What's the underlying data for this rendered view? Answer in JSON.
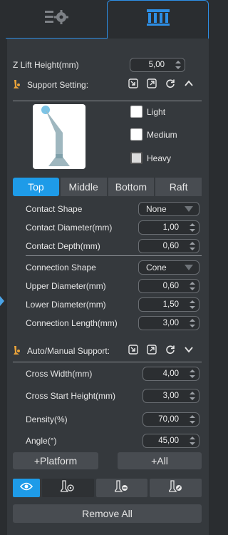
{
  "tabs": [
    {
      "name": "settings-tab",
      "icon": "list-gear-icon",
      "active": false
    },
    {
      "name": "support-tab",
      "icon": "support-pillars-icon",
      "active": true
    }
  ],
  "z_lift": {
    "label": "Z Lift Height(mm)",
    "value": "5,00"
  },
  "support_setting": {
    "title": "Support Setting:"
  },
  "density_options": [
    {
      "label": "Light",
      "checked": false
    },
    {
      "label": "Medium",
      "checked": false
    },
    {
      "label": "Heavy",
      "checked": true
    }
  ],
  "segments": [
    "Top",
    "Middle",
    "Bottom",
    "Raft"
  ],
  "active_segment": "Top",
  "top_params": {
    "contact_shape": {
      "label": "Contact Shape",
      "value": "None"
    },
    "contact_diameter": {
      "label": "Contact Diameter(mm)",
      "value": "1,00"
    },
    "contact_depth": {
      "label": "Contact Depth(mm)",
      "value": "0,60"
    }
  },
  "middle_params": {
    "connection_shape": {
      "label": "Connection Shape",
      "value": "Cone"
    },
    "upper_diameter": {
      "label": "Upper Diameter(mm)",
      "value": "0,60"
    },
    "lower_diameter": {
      "label": "Lower Diameter(mm)",
      "value": "1,50"
    },
    "connection_length": {
      "label": "Connection Length(mm)",
      "value": "3,00"
    }
  },
  "auto_support": {
    "title": "Auto/Manual Support:",
    "cross_width": {
      "label": "Cross Width(mm)",
      "value": "4,00"
    },
    "cross_start_height": {
      "label": "Cross Start Height(mm)",
      "value": "3,00"
    },
    "density": {
      "label": "Density(%)",
      "value": "70,00"
    },
    "angle": {
      "label": "Angle(°)",
      "value": "45,00"
    }
  },
  "buttons": {
    "platform": "+Platform",
    "all": "+All",
    "remove_all": "Remove All"
  },
  "colors": {
    "accent": "#1e9be8",
    "panel": "#35393d",
    "background": "#2a2d30",
    "icon_orange": "#e8a23a"
  }
}
